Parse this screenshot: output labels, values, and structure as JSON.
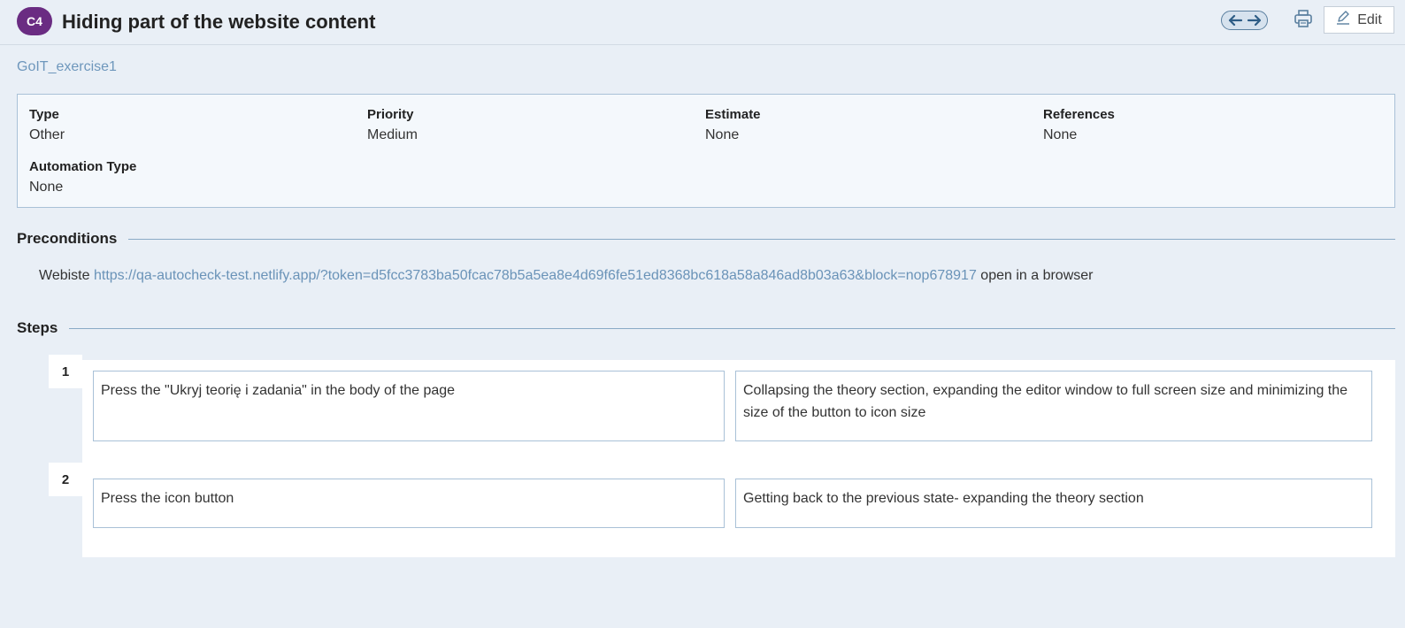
{
  "header": {
    "badge": "C4",
    "title": "Hiding part of the website content",
    "edit_label": "Edit"
  },
  "project": "GoIT_exercise1",
  "fields": [
    {
      "label": "Type",
      "value": "Other"
    },
    {
      "label": "Priority",
      "value": "Medium"
    },
    {
      "label": "Estimate",
      "value": "None"
    },
    {
      "label": "References",
      "value": "None"
    },
    {
      "label": "Automation Type",
      "value": "None"
    }
  ],
  "preconditions": {
    "heading": "Preconditions",
    "prefix": "Webiste",
    "url": "https://qa-autocheck-test.netlify.app/?token=d5fcc3783ba50fcac78b5a5ea8e4d69f6fe51ed8368bc618a58a846ad8b03a63&block=nop678917",
    "suffix": "open in a browser"
  },
  "steps": {
    "heading": "Steps",
    "items": [
      {
        "number": "1",
        "action": "Press the \"Ukryj teorię i zadania\" in the body of the page",
        "expected": "Collapsing the theory section, expanding the editor window to full screen size and minimizing the size of the button to icon size"
      },
      {
        "number": "2",
        "action": "Press the icon button",
        "expected": "Getting back to the previous state- expanding the theory section"
      }
    ]
  },
  "icons": {
    "prev": "arrow-left-icon",
    "next": "arrow-right-icon",
    "print": "printer-icon",
    "edit": "pencil-icon"
  },
  "colors": {
    "badge": "#6a2c82",
    "link": "#6a93b8",
    "background": "#e9eff6"
  }
}
